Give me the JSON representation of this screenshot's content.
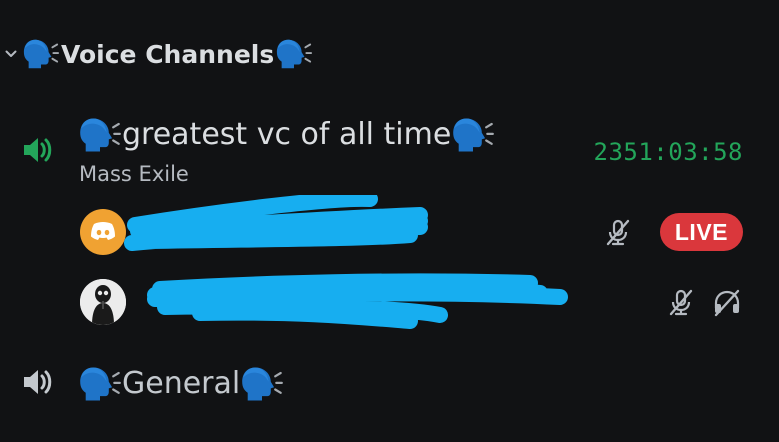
{
  "category": {
    "label": "Voice Channels",
    "emoji": "speaking-head",
    "expanded": true
  },
  "channels": [
    {
      "name": "greatest vc of all time",
      "emoji": "speaking-head",
      "status": "Mass Exile",
      "timer": "2351:03:58",
      "active": true,
      "users": [
        {
          "avatar": "discord-logo-orange",
          "name_redacted": true,
          "muted": true,
          "live_label": "LIVE"
        },
        {
          "avatar": "dark-figure",
          "name_redacted": true,
          "muted": true,
          "deafened": true
        }
      ]
    },
    {
      "name": "General",
      "emoji": "speaking-head",
      "active": false
    }
  ],
  "colors": {
    "background": "#111214",
    "text": "#dbdee1",
    "muted_text": "#b5bac1",
    "active_speaker": "#23a55a",
    "timer": "#23a55a",
    "live_badge": "#da373c",
    "emoji": "#1f74c8",
    "redaction": "#17aef0",
    "discord_avatar": "#f0a232"
  },
  "icons": {
    "chevron": "chevron-down-icon",
    "speaker": "speaker-icon",
    "mute": "microphone-muted-icon",
    "deafen": "headphones-deafened-icon"
  }
}
